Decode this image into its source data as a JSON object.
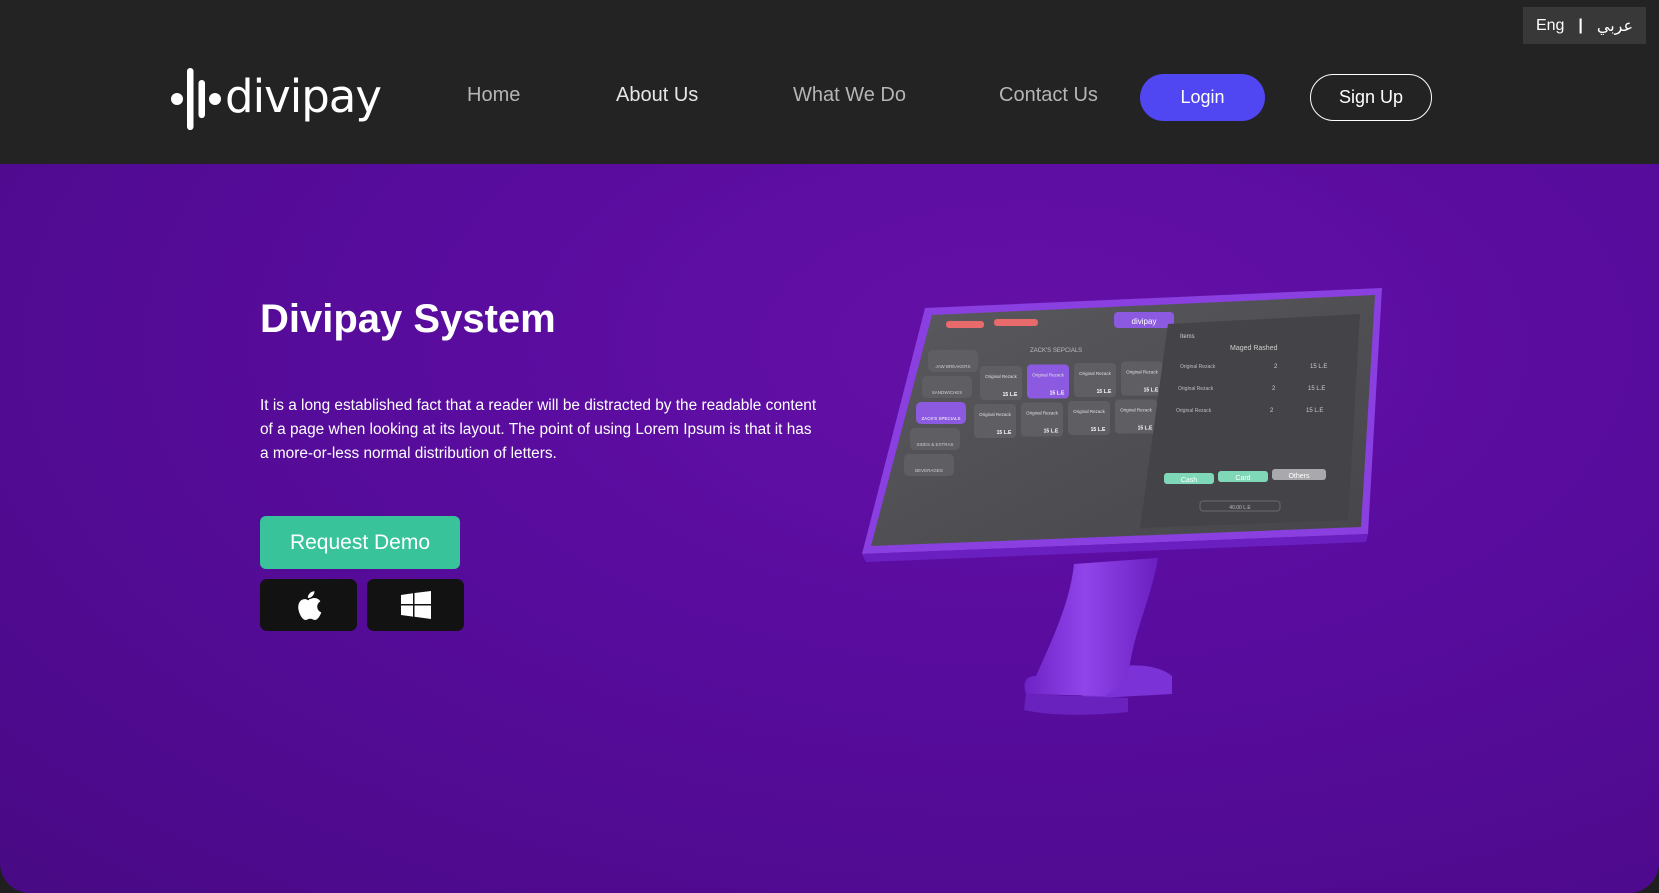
{
  "language_switch": {
    "english": "Eng",
    "separator": "|",
    "arabic": "عربي"
  },
  "header": {
    "logo_text": "divipay",
    "logo_icon": "sound-wave-icon",
    "nav": [
      {
        "label": "Home"
      },
      {
        "label": "About Us"
      },
      {
        "label": "What We Do"
      },
      {
        "label": "Contact Us"
      }
    ],
    "login_label": "Login",
    "signup_label": "Sign Up"
  },
  "hero": {
    "title": "Divipay System",
    "description": "It is a long established fact that a reader will be distracted by the readable content of a page when looking at its layout. The point of using Lorem Ipsum is that it has a more-or-less normal distribution of letters.",
    "demo_button_label": "Request Demo",
    "store_buttons": [
      {
        "icon": "apple-icon"
      },
      {
        "icon": "windows-icon"
      }
    ]
  },
  "kiosk_screen": {
    "brand": "divipay",
    "section_title": "ZACK'S SEPCIALS",
    "customer_name": "Maged Rashed",
    "items_header": "Items",
    "categories": [
      "JAW BREAKERS",
      "SANDWICHES",
      "ZACK'S SPECIALS",
      "SIDES & EXTRAS",
      "BEVERAGES"
    ],
    "product_name": "Original Rezack",
    "product_price": "15 L.E",
    "order_lines": [
      {
        "name": "Original Rezack",
        "qty": "2",
        "price": "15 L.E"
      },
      {
        "name": "Original Rezack",
        "qty": "2",
        "price": "15 L.E"
      },
      {
        "name": "Original Rezack",
        "qty": "2",
        "price": "15 L.E"
      }
    ],
    "payment_methods": [
      "Cash",
      "Card",
      "Others"
    ],
    "total": "40.00 L.E"
  },
  "colors": {
    "header_bg": "#232323",
    "hero_bg": "#590c9e",
    "login_bg": "#5046f2",
    "demo_bg": "#39c39b",
    "store_btn_bg": "#121212",
    "kiosk_purple": "#8a3fe0"
  }
}
